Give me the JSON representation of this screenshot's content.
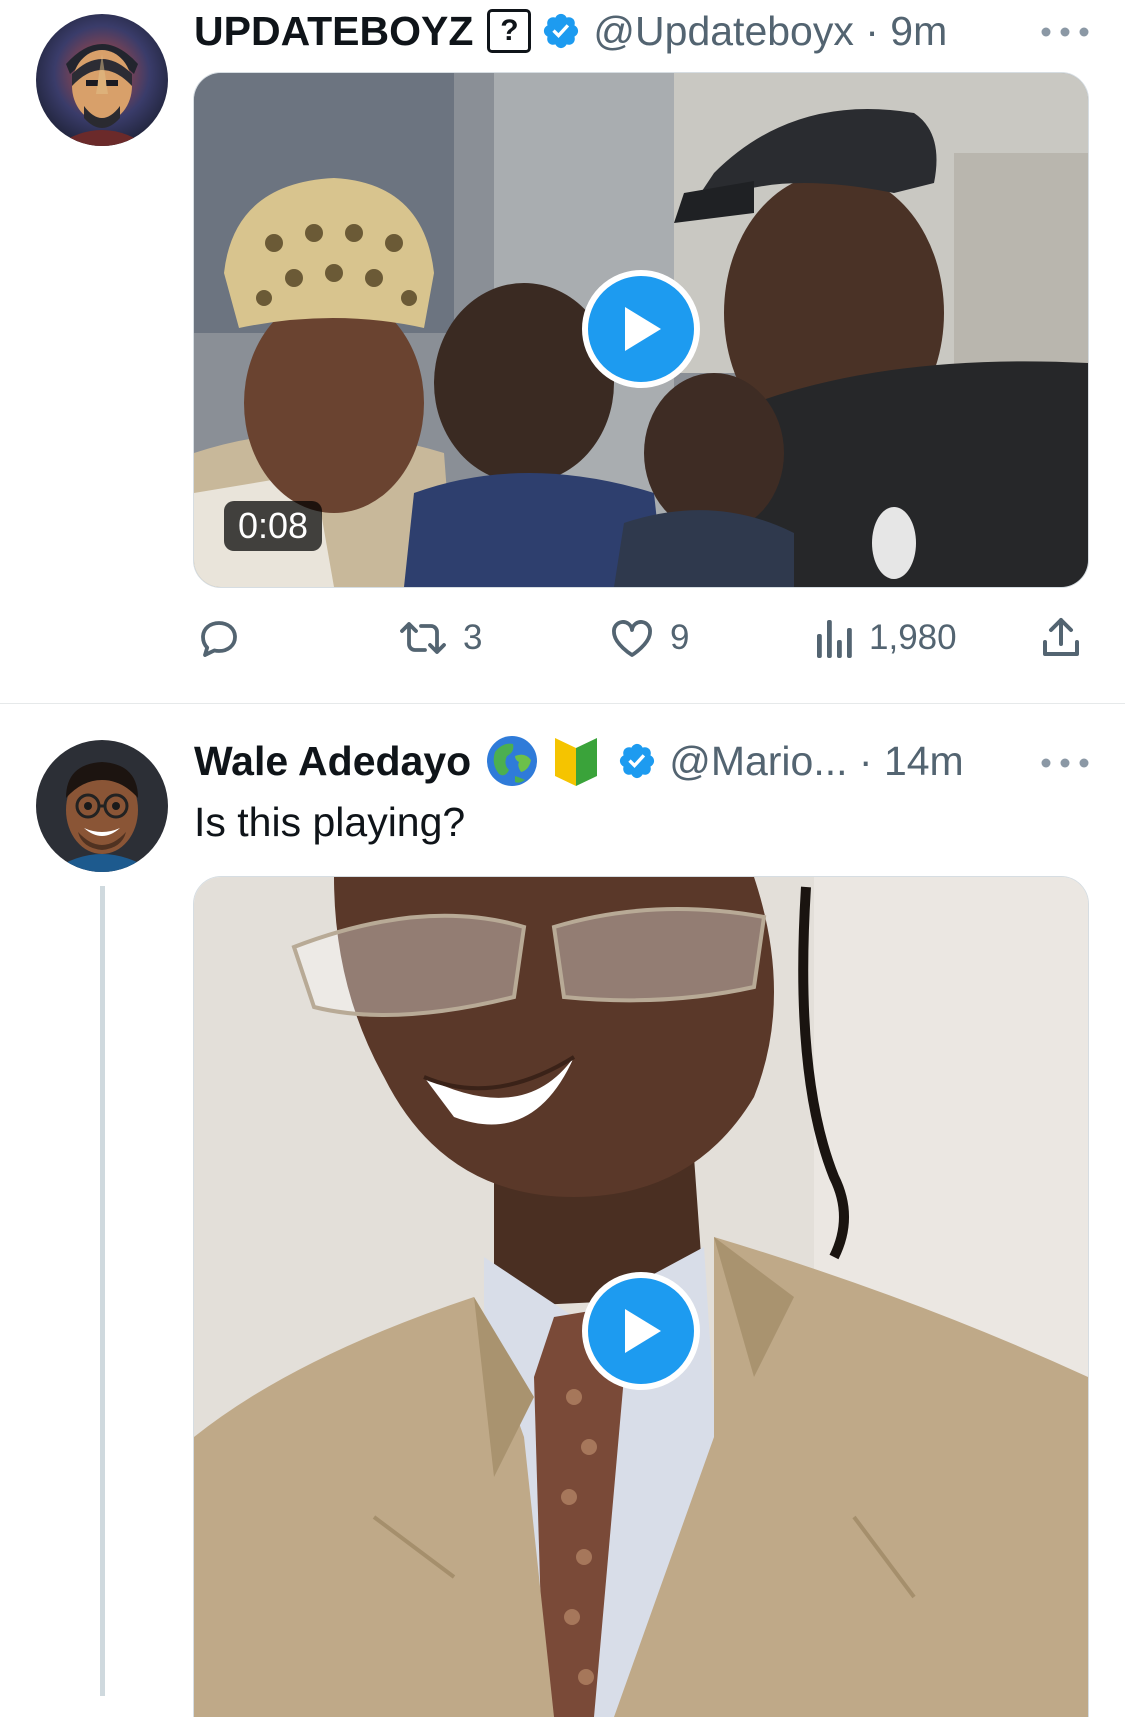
{
  "tweets": [
    {
      "display_name": "UPDATEBOYZ",
      "name_badge": "?",
      "handle_time": "@Updateboyx · 9m",
      "video_duration": "0:08",
      "actions": {
        "retweets": "3",
        "likes": "9",
        "views": "1,980"
      }
    },
    {
      "display_name": "Wale Adedayo",
      "handle_time": "@Mario... · 14m",
      "text": "Is this playing?"
    }
  ],
  "icons": {
    "verified": "verified-badge-icon",
    "more": "more-dots-icon",
    "play": "play-icon",
    "reply": "reply-icon",
    "retweet": "retweet-icon",
    "like": "heart-icon",
    "views": "views-chart-icon",
    "share": "share-icon",
    "globe": "globe-emoji-icon",
    "beginner": "beginner-emoji-icon"
  },
  "colors": {
    "verified_blue": "#1d9bf0",
    "secondary_text": "#536471",
    "play_blue": "#1d9bf0"
  }
}
